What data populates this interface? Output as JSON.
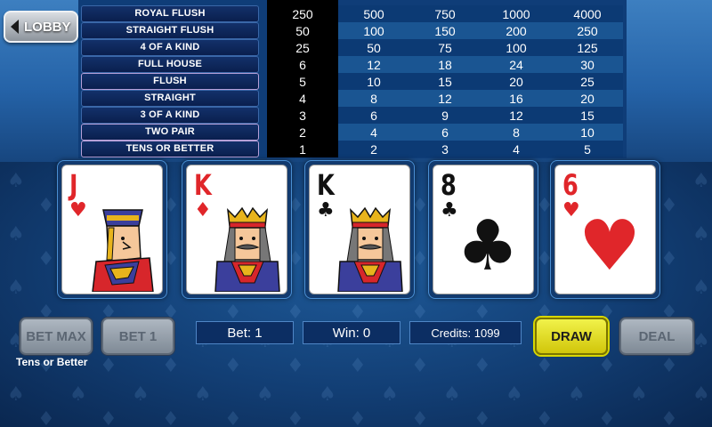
{
  "lobby_label": "LOBBY",
  "paytable": {
    "hands": [
      "ROYAL FLUSH",
      "STRAIGHT FLUSH",
      "4 OF A KIND",
      "FULL HOUSE",
      "FLUSH",
      "STRAIGHT",
      "3 OF A KIND",
      "TWO PAIR",
      "TENS OR BETTER"
    ],
    "payouts": [
      [
        "250",
        "500",
        "750",
        "1000",
        "4000"
      ],
      [
        "50",
        "100",
        "150",
        "200",
        "250"
      ],
      [
        "25",
        "50",
        "75",
        "100",
        "125"
      ],
      [
        "6",
        "12",
        "18",
        "24",
        "30"
      ],
      [
        "5",
        "10",
        "15",
        "20",
        "25"
      ],
      [
        "4",
        "8",
        "12",
        "16",
        "20"
      ],
      [
        "3",
        "6",
        "9",
        "12",
        "15"
      ],
      [
        "2",
        "4",
        "6",
        "8",
        "10"
      ],
      [
        "1",
        "2",
        "3",
        "4",
        "5"
      ]
    ],
    "active_column": 1
  },
  "cards": [
    {
      "rank": "J",
      "suit": "♥",
      "color": "red",
      "type": "face-jack"
    },
    {
      "rank": "K",
      "suit": "♦",
      "color": "red",
      "type": "face-king"
    },
    {
      "rank": "K",
      "suit": "♣",
      "color": "black",
      "type": "face-king"
    },
    {
      "rank": "8",
      "suit": "♣",
      "color": "black",
      "type": "pip"
    },
    {
      "rank": "6",
      "suit": "♥",
      "color": "red",
      "type": "pip"
    }
  ],
  "controls": {
    "bet_max": "BET MAX",
    "bet_one": "BET 1",
    "bet": "Bet: 1",
    "win": "Win: 0",
    "credits": "Credits: 1099",
    "draw": "DRAW",
    "deal": "DEAL"
  },
  "game_name": "Tens or Better",
  "colors": {
    "draw_button": "#e3dd1e",
    "red_suit": "#e0262a",
    "felt": "#123e74"
  }
}
